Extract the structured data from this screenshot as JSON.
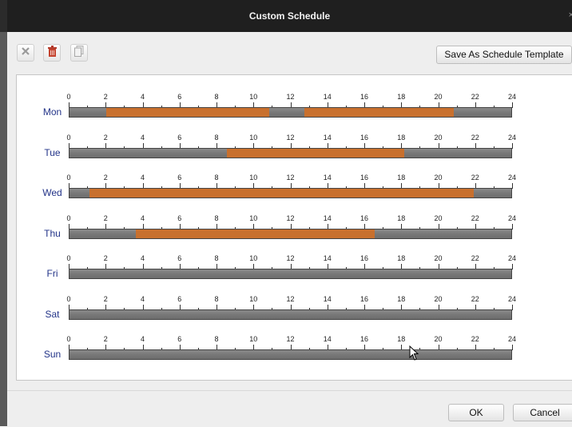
{
  "window": {
    "title": "Custom Schedule",
    "close_glyph": "×"
  },
  "toolbar": {
    "icons": [
      "delete-x-icon",
      "trash-icon",
      "copy-icon"
    ],
    "save_template_label": "Save As Schedule Template"
  },
  "timeline": {
    "tick_labels": [
      "0",
      "2",
      "4",
      "6",
      "8",
      "10",
      "12",
      "14",
      "16",
      "18",
      "20",
      "22",
      "24"
    ],
    "segment_color": "#c8702e",
    "bar_color": "#7e7e7e"
  },
  "days": [
    {
      "label": "Mon",
      "segments": [
        {
          "start": 2.0,
          "end": 10.8
        },
        {
          "start": 12.7,
          "end": 20.8
        }
      ]
    },
    {
      "label": "Tue",
      "segments": [
        {
          "start": 8.5,
          "end": 18.1
        }
      ]
    },
    {
      "label": "Wed",
      "segments": [
        {
          "start": 1.1,
          "end": 21.9
        }
      ]
    },
    {
      "label": "Thu",
      "segments": [
        {
          "start": 3.6,
          "end": 16.5
        }
      ]
    },
    {
      "label": "Fri",
      "segments": []
    },
    {
      "label": "Sat",
      "segments": []
    },
    {
      "label": "Sun",
      "segments": []
    }
  ],
  "footer": {
    "ok_label": "OK",
    "cancel_label": "Cancel"
  }
}
